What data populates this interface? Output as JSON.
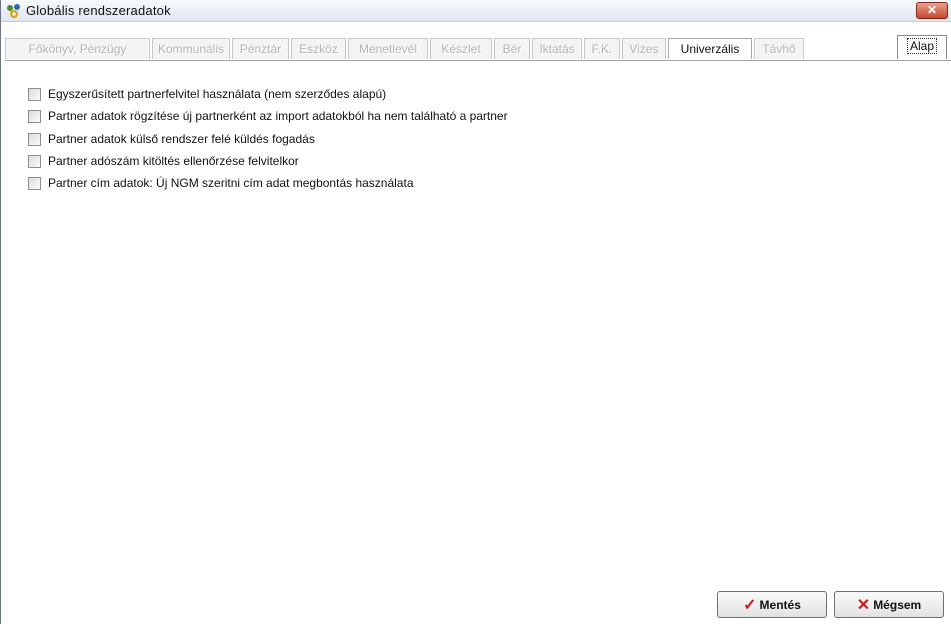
{
  "window": {
    "title": "Globális rendszeradatok",
    "close_label": "✕"
  },
  "tabs": [
    {
      "label": "Főkönyv, Pénzügy",
      "state": "disabled"
    },
    {
      "label": "Kommunális",
      "state": "disabled"
    },
    {
      "label": "Pénztár",
      "state": "disabled"
    },
    {
      "label": "Eszköz",
      "state": "disabled"
    },
    {
      "label": "Menetlevél",
      "state": "disabled"
    },
    {
      "label": "Készlet",
      "state": "disabled"
    },
    {
      "label": "Bér",
      "state": "disabled"
    },
    {
      "label": "Iktatás",
      "state": "disabled"
    },
    {
      "label": "F.K.",
      "state": "disabled"
    },
    {
      "label": "Vizes",
      "state": "disabled"
    },
    {
      "label": "Univerzális",
      "state": "enabled"
    },
    {
      "label": "Távhő",
      "state": "disabled"
    },
    {
      "label": "Alap",
      "state": "selected"
    }
  ],
  "options": [
    {
      "label": "Egyszerűsített partnerfelvitel használata (nem szerződes alapú)",
      "checked": false
    },
    {
      "label": "Partner adatok rögzítése új partnerként az import adatokból ha nem található a partner",
      "checked": false
    },
    {
      "label": "Partner adatok külső rendszer felé küldés fogadás",
      "checked": false
    },
    {
      "label": "Partner adószám kitöltés ellenőrzése felvitelkor",
      "checked": false
    },
    {
      "label": "Partner cím adatok: Új NGM szeritni cím adat megbontás használata",
      "checked": false
    }
  ],
  "buttons": {
    "save_label": "Mentés",
    "cancel_label": "Mégsem"
  },
  "colors": {
    "accent_red": "#c0201e",
    "title_bar": "#dfe6ef"
  }
}
